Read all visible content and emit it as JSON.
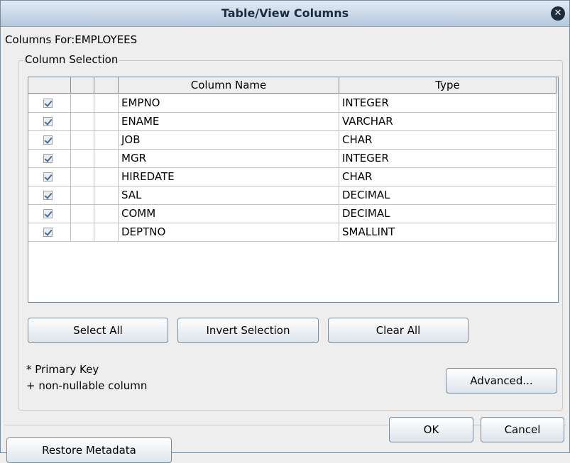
{
  "dialog": {
    "title": "Table/View Columns",
    "close_icon": "close-icon"
  },
  "columns_for_label": "Columns For:EMPLOYEES",
  "column_selection": {
    "group_title": "Column Selection",
    "headers": {
      "blank1": "",
      "blank2": "",
      "blank3": "",
      "column_name": "Column Name",
      "type": "Type"
    },
    "rows": [
      {
        "checked": true,
        "name": "EMPNO",
        "type": "INTEGER"
      },
      {
        "checked": true,
        "name": "ENAME",
        "type": "VARCHAR"
      },
      {
        "checked": true,
        "name": "JOB",
        "type": "CHAR"
      },
      {
        "checked": true,
        "name": "MGR",
        "type": "INTEGER"
      },
      {
        "checked": true,
        "name": "HIREDATE",
        "type": "CHAR"
      },
      {
        "checked": true,
        "name": "SAL",
        "type": "DECIMAL"
      },
      {
        "checked": true,
        "name": "COMM",
        "type": "DECIMAL"
      },
      {
        "checked": true,
        "name": "DEPTNO",
        "type": "SMALLINT"
      }
    ],
    "buttons": {
      "select_all": "Select All",
      "invert_selection": "Invert Selection",
      "clear_all": "Clear All"
    },
    "legend": {
      "primary_key": "* Primary Key",
      "non_nullable": "+ non-nullable column"
    },
    "advanced": "Advanced..."
  },
  "footer": {
    "restore_metadata": "Restore Metadata",
    "ok": "OK",
    "cancel": "Cancel"
  }
}
